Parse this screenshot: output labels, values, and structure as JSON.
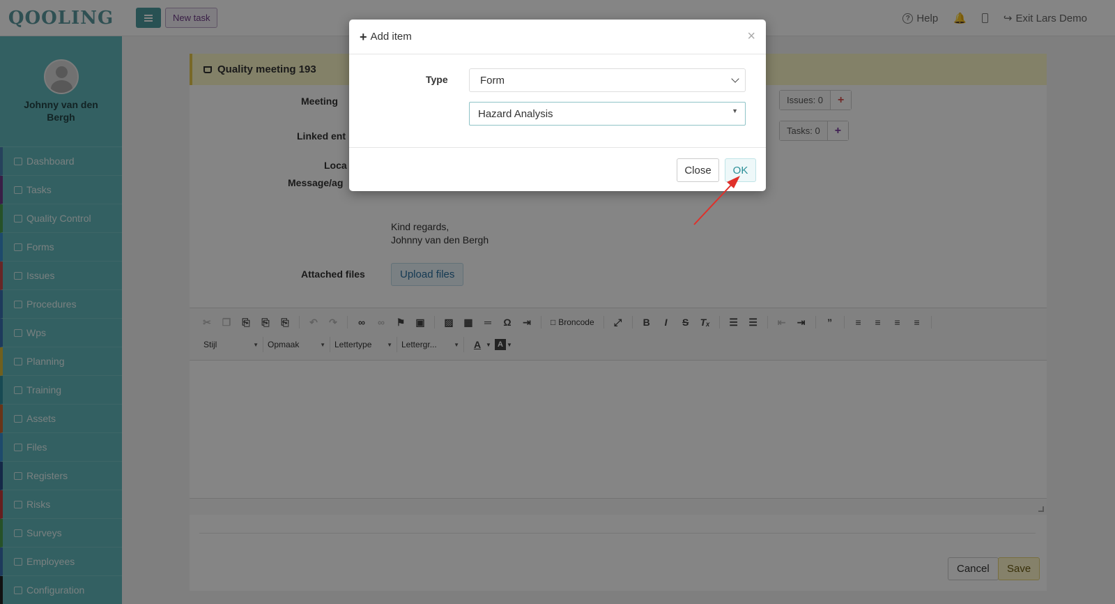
{
  "app": {
    "logo": "QOOLING"
  },
  "topbar": {
    "new_task_label": "New task",
    "help_label": "Help",
    "exit_label": "Exit Lars Demo"
  },
  "sidebar": {
    "user_name": "Johnny van den Bergh",
    "items": [
      {
        "label": "Dashboard",
        "color": "#4a7fb0",
        "icon": "monitor-icon"
      },
      {
        "label": "Tasks",
        "color": "#6d3a86",
        "icon": "checkbox-icon"
      },
      {
        "label": "Quality Control",
        "color": "#4a9c4e",
        "icon": "book-icon"
      },
      {
        "label": "Forms",
        "color": "#3b8fd0",
        "icon": "document-icon"
      },
      {
        "label": "Issues",
        "color": "#c64a4a",
        "icon": "bell-icon"
      },
      {
        "label": "Procedures",
        "color": "#3b6fb0",
        "icon": "list-icon"
      },
      {
        "label": "Wps",
        "color": "#3b6fb0",
        "icon": "list-icon"
      },
      {
        "label": "Planning",
        "color": "#d6b93a",
        "icon": "calendar-icon"
      },
      {
        "label": "Training",
        "color": "#2f8fa0",
        "icon": "graduation-icon"
      },
      {
        "label": "Assets",
        "color": "#c8642f",
        "icon": "wrench-icon"
      },
      {
        "label": "Files",
        "color": "#3b8fd0",
        "icon": "file-icon"
      },
      {
        "label": "Registers",
        "color": "#2a4f8a",
        "icon": "table-icon"
      },
      {
        "label": "Risks",
        "color": "#c43a3a",
        "icon": "warning-icon"
      },
      {
        "label": "Surveys",
        "color": "#4a9c4e",
        "icon": "chat-icon"
      },
      {
        "label": "Employees",
        "color": "#3b6fb0",
        "icon": "users-icon"
      },
      {
        "label": "Configuration",
        "color": "#222222",
        "icon": "gear-icon"
      }
    ]
  },
  "page": {
    "title": "Quality meeting 193",
    "labels": {
      "meeting": "Meeting",
      "linked": "Linked ent",
      "location": "Loca",
      "message": "Message/ag",
      "attached": "Attached files"
    },
    "issues_label": "Issues: 0",
    "tasks_label": "Tasks: 0",
    "plus_symbol": "+",
    "regards_line1": "Kind regards,",
    "regards_line2": "Johnny van den Bergh",
    "upload_label": "Upload files",
    "cancel_label": "Cancel",
    "save_label": "Save"
  },
  "editor": {
    "broncode_label": "Broncode",
    "combos": [
      "Stijl",
      "Opmaak",
      "Lettertype",
      "Lettergr..."
    ]
  },
  "modal": {
    "title": "Add item",
    "type_label": "Type",
    "type_value": "Form",
    "form_value": "Hazard Analysis",
    "close_label": "Close",
    "ok_label": "OK"
  }
}
